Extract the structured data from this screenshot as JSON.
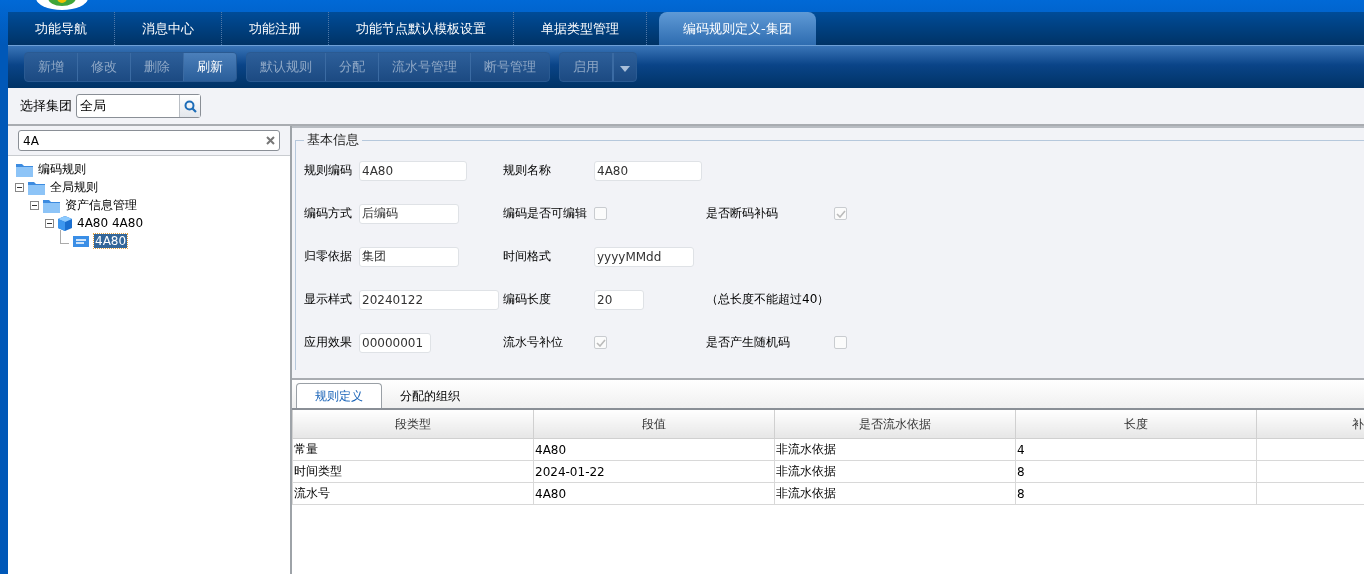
{
  "nav_tabs": [
    {
      "label": "功能导航",
      "selected": false
    },
    {
      "label": "消息中心",
      "selected": false
    },
    {
      "label": "功能注册",
      "selected": false
    },
    {
      "label": "功能节点默认模板设置",
      "selected": false
    },
    {
      "label": "单据类型管理",
      "selected": false
    },
    {
      "label": "编码规则定义-集团",
      "selected": true
    }
  ],
  "toolbar": {
    "groups": [
      [
        {
          "label": "新增",
          "disabled": true
        },
        {
          "label": "修改",
          "disabled": true
        },
        {
          "label": "删除",
          "disabled": true
        },
        {
          "label": "刷新",
          "disabled": false
        }
      ],
      [
        {
          "label": "默认规则",
          "disabled": true
        },
        {
          "label": "分配",
          "disabled": true
        },
        {
          "label": "流水号管理",
          "disabled": true
        },
        {
          "label": "断号管理",
          "disabled": true
        }
      ],
      [
        {
          "label": "启用",
          "disabled": true,
          "dropdown": true
        }
      ]
    ]
  },
  "group_filter": {
    "label": "选择集团",
    "value": "全局"
  },
  "tree": {
    "search": "4A",
    "nodes": [
      {
        "label": "编码规则",
        "kind": "folder",
        "selected": false,
        "children": [
          {
            "label": "全局规则",
            "kind": "folder",
            "expanded": true,
            "selected": false,
            "children": [
              {
                "label": "资产信息管理",
                "kind": "folder",
                "expanded": true,
                "selected": false,
                "children": [
                  {
                    "label": "4A80  4A80",
                    "kind": "cube",
                    "expanded": true,
                    "selected": false,
                    "children": [
                      {
                        "label": "4A80",
                        "kind": "doc",
                        "selected": true
                      }
                    ]
                  }
                ]
              }
            ]
          }
        ]
      }
    ]
  },
  "basic_info": {
    "title": "基本信息",
    "rows": [
      [
        {
          "kind": "field",
          "label": "规则编码",
          "value": "4A80"
        },
        {
          "kind": "field",
          "label": "规则名称",
          "value": "4A80"
        }
      ],
      [
        {
          "kind": "field",
          "label": "编码方式",
          "value": "后编码"
        },
        {
          "kind": "checkbox",
          "label": "编码是否可编辑",
          "checked": false
        },
        {
          "kind": "checkbox",
          "label": "是否断码补码",
          "checked": true
        }
      ],
      [
        {
          "kind": "field",
          "label": "归零依据",
          "value": "集团"
        },
        {
          "kind": "field",
          "label": "时间格式",
          "value": "yyyyMMdd"
        }
      ],
      [
        {
          "kind": "field",
          "label": "显示样式",
          "value": "20240122"
        },
        {
          "kind": "field",
          "label": "编码长度",
          "value": "20"
        },
        {
          "kind": "note",
          "text": "（总长度不能超过40）"
        }
      ],
      [
        {
          "kind": "field",
          "label": "应用效果",
          "value": "00000001"
        },
        {
          "kind": "checkbox",
          "label": "流水号补位",
          "checked": true
        },
        {
          "kind": "checkbox",
          "label": "是否产生随机码",
          "checked": false
        }
      ]
    ]
  },
  "detail_tabs": [
    {
      "label": "规则定义",
      "selected": true
    },
    {
      "label": "分配的组织",
      "selected": false
    }
  ],
  "table": {
    "columns": [
      "段类型",
      "段值",
      "是否流水依据",
      "长度",
      "补"
    ],
    "rows": [
      [
        "常量",
        "4A80",
        "非流水依据",
        "4",
        ""
      ],
      [
        "时间类型",
        "2024-01-22",
        "非流水依据",
        "8",
        ""
      ],
      [
        "流水号",
        "4A80",
        "非流水依据",
        "8",
        ""
      ]
    ]
  }
}
